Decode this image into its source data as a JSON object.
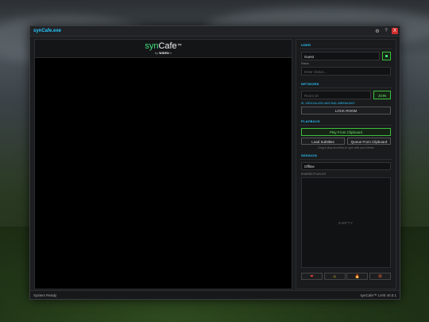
{
  "window": {
    "title": "synCafe.exe",
    "settings_icon": "⚙",
    "help_icon": "?",
    "close_icon": "X"
  },
  "player": {
    "logo_syn": "syn",
    "logo_cafe": "Cafe",
    "logo_tm": "™",
    "byline_prefix": "by",
    "byline_brand": "WIDEN",
    "byline_caret": "▾"
  },
  "user": {
    "section": "USER",
    "name_value": "Guest",
    "status_label": "Status",
    "status_placeholder": "Enter Status..."
  },
  "network": {
    "section": "NETWORK",
    "room_placeholder": "Room ID",
    "join_label": "JOIN",
    "id_text": "ID: 1267e12a-4761-4622-9d11-4f38236c7bf47",
    "lock_label": "LOCK ROOM"
  },
  "playback": {
    "section": "PLAYBACK",
    "play_clipboard": "Play From Clipboard",
    "load_subtitles": "Load Subtitles",
    "queue_clipboard": "Queue From Clipboard",
    "hint": "Drag & drop local files to sync with your friends"
  },
  "session": {
    "section": "SESSION",
    "mode_value": "Offline",
    "shared_label": "SHARED PLAYLIST",
    "empty_label": "EMPTY"
  },
  "reactions": [
    "❤",
    "☺",
    "🔥",
    "✪"
  ],
  "status_bar": {
    "left": "System Ready",
    "right": "synCafe™ LIVE v0.0.1"
  },
  "colors": {
    "accent": "#29c6ff",
    "brand_green": "#3fe07a",
    "close_red": "#d22d2d"
  }
}
